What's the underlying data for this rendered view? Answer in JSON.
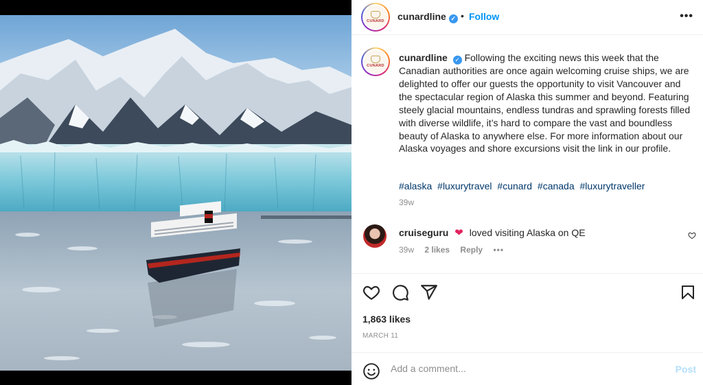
{
  "post": {
    "username": "cunardline",
    "verified_mark": "✓",
    "separator": "•",
    "follow_label": "Follow",
    "more_label": "•••",
    "avatar_brand": "CUNARD",
    "caption": "Following the exciting news this week that the Canadian authorities are once again welcoming cruise ships, we are delighted to offer our guests the opportunity to visit Vancouver and the spectacular region of Alaska this summer and beyond. Featuring steely glacial mountains, endless tundras and sprawling forests filled with diverse wildlife, it’s hard to compare the vast and boundless beauty of Alaska to anywhere else. For more information about our Alaska voyages and shore excursions visit the link in our profile.",
    "hashtags": [
      "#alaska",
      "#luxurytravel",
      "#cunard",
      "#canada",
      "#luxurytraveller"
    ],
    "caption_time": "39w",
    "likes": "1,863 likes",
    "date": "MARCH 11"
  },
  "comment": {
    "username": "cruiseguru",
    "emoji": "❤",
    "text": "loved visiting Alaska on QE",
    "time": "39w",
    "likes": "2 likes",
    "reply_label": "Reply",
    "more_label": "•••"
  },
  "add_comment": {
    "placeholder": "Add a comment...",
    "post_label": "Post"
  },
  "icons": {
    "like": "heart-icon",
    "comment": "comment-icon",
    "share": "paper-plane-icon",
    "save": "bookmark-icon",
    "emoji": "smiley-icon",
    "more": "more-dots-icon",
    "verified": "verified-badge-icon"
  },
  "colors": {
    "link_blue": "#0095f6",
    "hashtag": "#00376b",
    "muted": "#8e8e8e",
    "verified": "#3897f0"
  }
}
